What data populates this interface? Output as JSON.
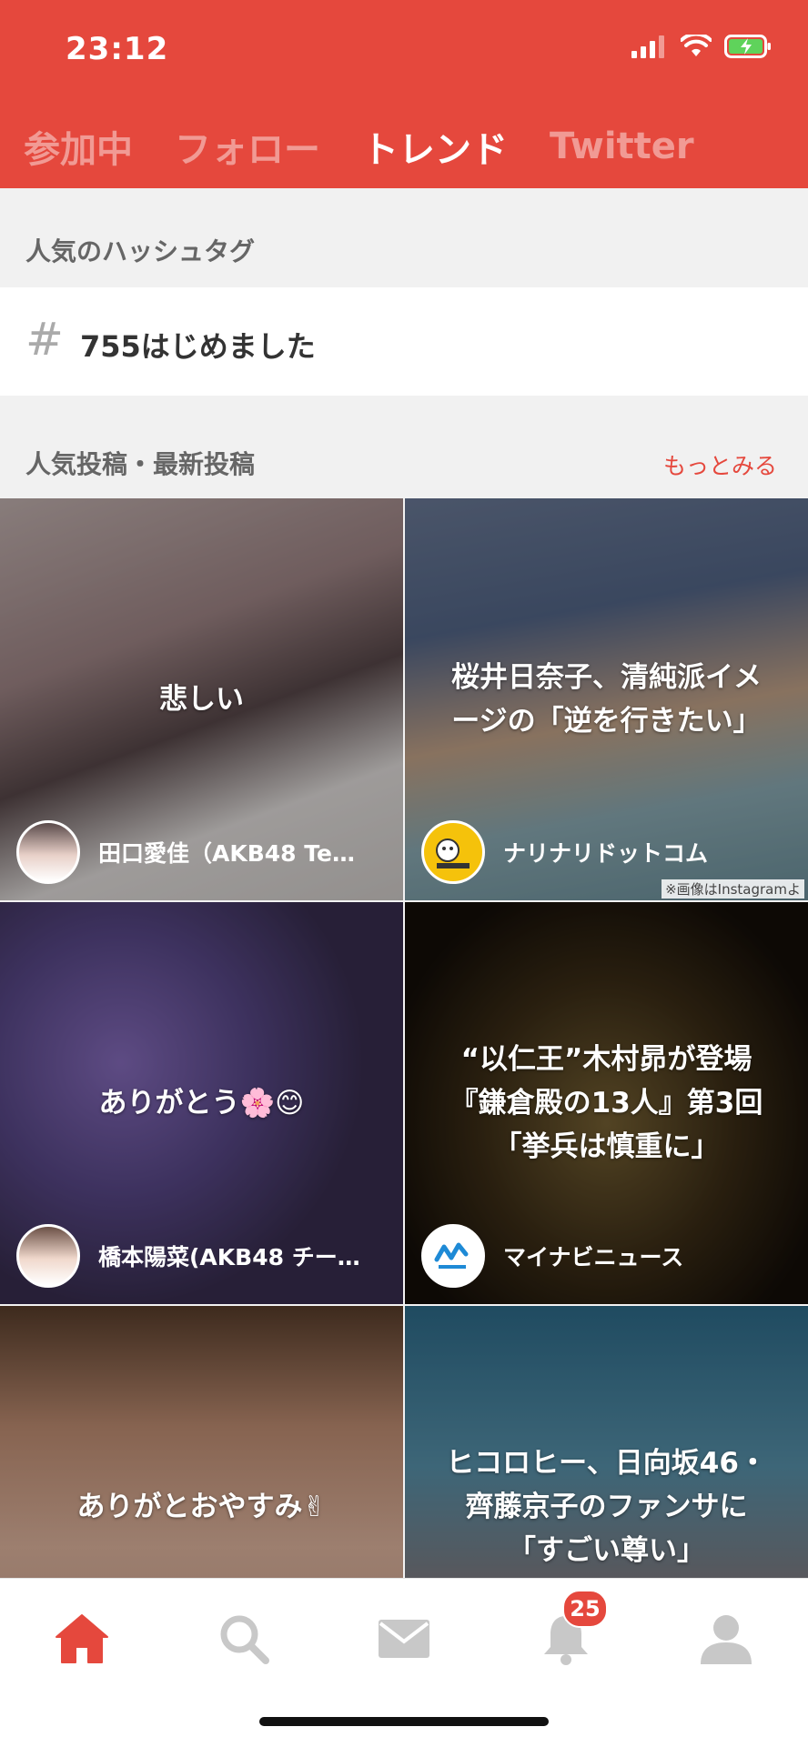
{
  "status_bar": {
    "time": "23:12"
  },
  "tabs": [
    {
      "label": "参加中",
      "active": false
    },
    {
      "label": "フォロー",
      "active": false
    },
    {
      "label": "トレンド",
      "active": true
    },
    {
      "label": "Twitter",
      "active": false
    }
  ],
  "popular_hashtags": {
    "title": "人気のハッシュタグ",
    "items": [
      {
        "icon": "#",
        "text": "755はじめました"
      }
    ]
  },
  "posts": {
    "title": "人気投稿・最新投稿",
    "more_label": "もっとみる",
    "items": [
      {
        "caption": "悲しい",
        "author": "田口愛佳（AKB48 Te…",
        "credit": ""
      },
      {
        "caption": "桜井日奈子、清純派イメ\nージの「逆を行きたい」",
        "author": "ナリナリドットコム",
        "credit": "※画像はInstagramよ"
      },
      {
        "caption": "ありがとう🌸😊",
        "author": "橋本陽菜(AKB48 チー…",
        "credit": ""
      },
      {
        "caption": "“以仁王”木村昴が登場\n『鎌倉殿の13人』第3回\n「挙兵は慎重に」",
        "author": "マイナビニュース",
        "credit": ""
      },
      {
        "caption": "ありがとおやすみ✌",
        "author": "",
        "credit": ""
      },
      {
        "caption": "ヒコロヒー、日向坂46・\n齊藤京子のファンサに\n「すごい尊い」",
        "author": "",
        "credit": ""
      }
    ]
  },
  "bottom_nav": {
    "items": [
      {
        "icon": "home-icon",
        "active": true
      },
      {
        "icon": "search-icon",
        "active": false
      },
      {
        "icon": "mail-icon",
        "active": false
      },
      {
        "icon": "bell-icon",
        "active": false,
        "badge": "25"
      },
      {
        "icon": "profile-icon",
        "active": false
      }
    ]
  },
  "colors": {
    "accent": "#e5483d",
    "inactive_icon": "#c8c8c8"
  }
}
